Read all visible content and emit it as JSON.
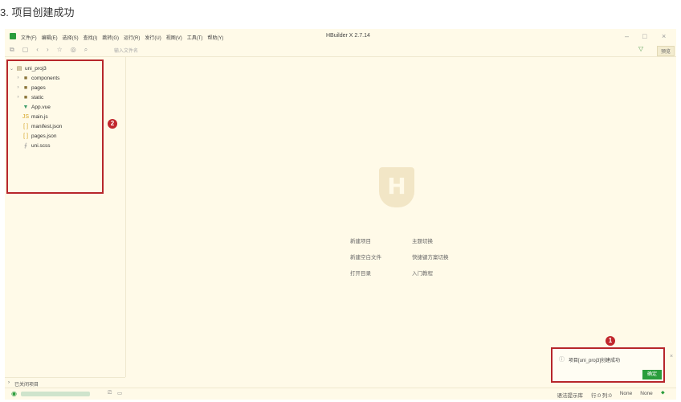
{
  "caption": "3. 项目创建成功",
  "menubar": {
    "items": [
      "文件(F)",
      "编辑(E)",
      "选择(S)",
      "查找(I)",
      "跳转(G)",
      "运行(R)",
      "发行(U)",
      "视图(V)",
      "工具(T)",
      "帮助(Y)"
    ],
    "title": "HBuilder X 2.7.14",
    "minimize": "–",
    "maximize": "□",
    "close": "×"
  },
  "toolbar": {
    "search_placeholder": "输入文件名",
    "preview_label": "预览"
  },
  "tree": {
    "items": [
      {
        "label": "uni_proj3",
        "icon": "project-icon"
      },
      {
        "label": "components",
        "icon": "folder-icon"
      },
      {
        "label": "pages",
        "icon": "folder-icon"
      },
      {
        "label": "static",
        "icon": "folder-icon"
      },
      {
        "label": "App.vue",
        "icon": "vue-icon"
      },
      {
        "label": "main.js",
        "icon": "js-icon"
      },
      {
        "label": "manifest.json",
        "icon": "json-icon"
      },
      {
        "label": "pages.json",
        "icon": "json-icon"
      },
      {
        "label": "uni.scss",
        "icon": "scss-icon"
      }
    ]
  },
  "badges": {
    "one": "1",
    "two": "2"
  },
  "welcome": {
    "new_project": "新建项目",
    "theme_switch": "主题切换",
    "new_blank_file": "新建空白文件",
    "shortcut_scheme": "快捷键方案切换",
    "open_dir": "打开目录",
    "tutorial": "入门教程"
  },
  "sidebar_bottom": {
    "closed_projects": "已关闭项目"
  },
  "status": {
    "syntax_hint": "语法提示库",
    "position": "行:0  列:0",
    "encoding": "None",
    "language": "None"
  },
  "notification": {
    "message": "项目[uni_proj3]创建成功",
    "ok_label": "确定"
  },
  "colors": {
    "accent": "#2a9d3c",
    "highlight": "#b7262b",
    "background": "#fffae8"
  }
}
